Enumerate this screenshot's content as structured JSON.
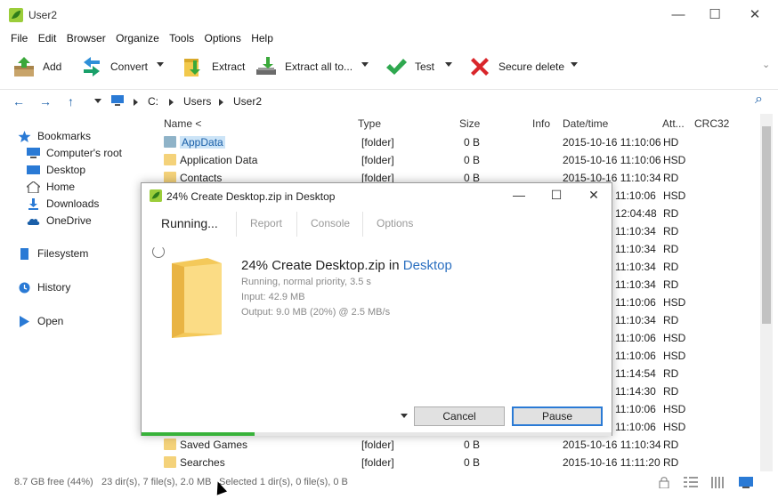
{
  "window": {
    "title": "User2",
    "min": "—",
    "max": "☐",
    "close": "✕"
  },
  "menu": [
    "File",
    "Edit",
    "Browser",
    "Organize",
    "Tools",
    "Options",
    "Help"
  ],
  "toolbar": {
    "add": "Add",
    "convert": "Convert",
    "extract": "Extract",
    "extract_all": "Extract all to...",
    "test": "Test",
    "secure_delete": "Secure delete",
    "overflow": "⌄"
  },
  "address": {
    "back": "←",
    "forward": "→",
    "up": "↑",
    "crumbs": [
      "C:",
      "Users",
      "User2"
    ],
    "search": "⌕"
  },
  "sidebar": {
    "bookmarks": "Bookmarks",
    "bookmark_items": [
      "Computer's root",
      "Desktop",
      "Home",
      "Downloads",
      "OneDrive"
    ],
    "filesystem": "Filesystem",
    "history": "History",
    "open": "Open"
  },
  "columns": {
    "name": "Name <",
    "type": "Type",
    "size": "Size",
    "info": "Info",
    "datetime": "Date/time",
    "attr": "Att...",
    "crc": "CRC32"
  },
  "files": [
    {
      "name": "AppData",
      "type": "[folder]",
      "size": "0 B",
      "date": "2015-10-16 11:10:06",
      "attr": "HD"
    },
    {
      "name": "Application Data",
      "type": "[folder]",
      "size": "0 B",
      "date": "2015-10-16 11:10:06",
      "attr": "HSD"
    },
    {
      "name": "Contacts",
      "type": "[folder]",
      "size": "0 B",
      "date": "2015-10-16 11:10:34",
      "attr": "RD"
    },
    {
      "name": "",
      "type": "",
      "size": "",
      "date": "11:10:06",
      "attr": "HSD"
    },
    {
      "name": "",
      "type": "",
      "size": "",
      "date": "12:04:48",
      "attr": "RD"
    },
    {
      "name": "",
      "type": "",
      "size": "",
      "date": "11:10:34",
      "attr": "RD"
    },
    {
      "name": "",
      "type": "",
      "size": "",
      "date": "11:10:34",
      "attr": "RD"
    },
    {
      "name": "",
      "type": "",
      "size": "",
      "date": "11:10:34",
      "attr": "RD"
    },
    {
      "name": "",
      "type": "",
      "size": "",
      "date": "11:10:34",
      "attr": "RD"
    },
    {
      "name": "",
      "type": "",
      "size": "",
      "date": "11:10:06",
      "attr": "HSD"
    },
    {
      "name": "",
      "type": "",
      "size": "",
      "date": "11:10:34",
      "attr": "RD"
    },
    {
      "name": "",
      "type": "",
      "size": "",
      "date": "11:10:06",
      "attr": "HSD"
    },
    {
      "name": "",
      "type": "",
      "size": "",
      "date": "11:10:06",
      "attr": "HSD"
    },
    {
      "name": "",
      "type": "",
      "size": "",
      "date": "11:14:54",
      "attr": "RD"
    },
    {
      "name": "",
      "type": "",
      "size": "",
      "date": "11:14:30",
      "attr": "RD"
    },
    {
      "name": "",
      "type": "",
      "size": "",
      "date": "11:10:06",
      "attr": "HSD"
    },
    {
      "name": "",
      "type": "",
      "size": "",
      "date": "11:10:06",
      "attr": "HSD"
    },
    {
      "name": "Saved Games",
      "type": "[folder]",
      "size": "0 B",
      "date": "2015-10-16 11:10:34",
      "attr": "RD"
    },
    {
      "name": "Searches",
      "type": "[folder]",
      "size": "0 B",
      "date": "2015-10-16 11:11:20",
      "attr": "RD"
    }
  ],
  "status": {
    "free": "8.7 GB free (44%)",
    "totals": "23 dir(s), 7 file(s), 2.0 MB",
    "selected": "Selected 1 dir(s), 0 file(s), 0 B"
  },
  "dialog": {
    "title": "24% Create Desktop.zip in Desktop",
    "tabs": [
      "Running...",
      "Report",
      "Console",
      "Options"
    ],
    "job_prefix": "24% Create Desktop.zip in ",
    "job_link": "Desktop",
    "line1": "Running, normal priority, 3.5 s",
    "line2": "Input: 42.9 MB",
    "line3": "Output: 9.0 MB (20%) @ 2.5 MB/s",
    "cancel": "Cancel",
    "pause": "Pause",
    "progress": 0.24
  },
  "colors": {
    "accent": "#2a7ad5",
    "progress": "#38b23a",
    "folder": "#f4d27a"
  }
}
